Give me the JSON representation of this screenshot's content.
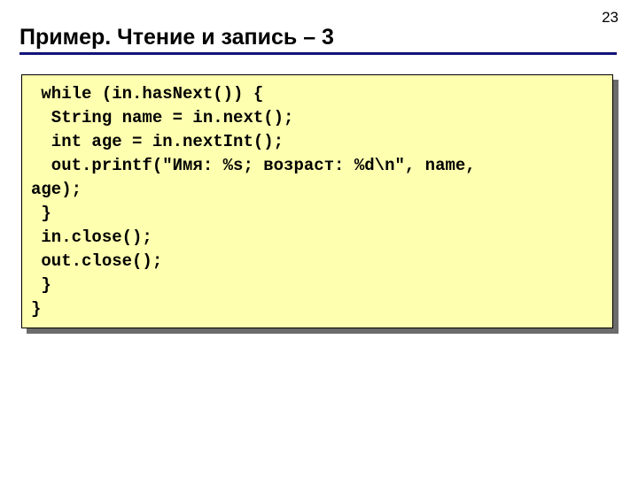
{
  "page_number": "23",
  "title": "Пример. Чтение и запись – 3",
  "code": " while (in.hasNext()) {\n  String name = in.next();\n  int age = in.nextInt();\n  out.printf(\"Имя: %s; возраст: %d\\n\", name,\nage);\n }\n in.close();\n out.close();\n }\n}"
}
